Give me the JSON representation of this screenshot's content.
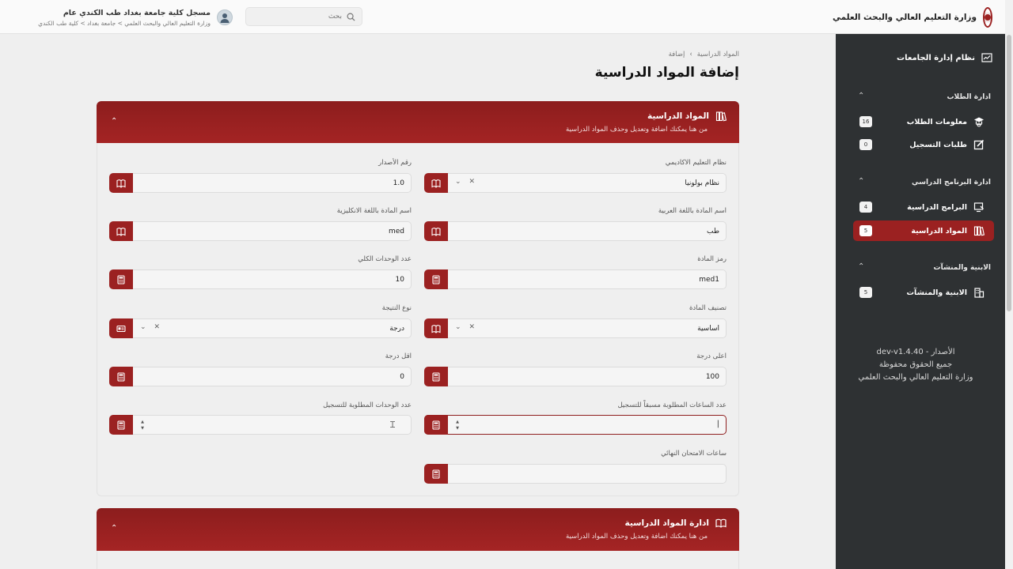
{
  "brand": {
    "title": "وزارة التعليم العالي والبحث العلمي"
  },
  "header": {
    "search_placeholder": "بحث",
    "user_name": "مسجل كلية جامعة بغداد طب الكندي عام",
    "user_path": "وزارة التعليم العالي والبحث العلمي > جامعة بغداد > كلية طب الكندي"
  },
  "sidebar": {
    "home": "نظام إدارة الجامعات",
    "sections": [
      {
        "title": "ادارة الطلاب",
        "items": [
          {
            "label": "معلومات الطلاب",
            "count": "16",
            "icon": "graduate-icon"
          },
          {
            "label": "طلبات التسجيل",
            "count": "0",
            "icon": "edit-icon"
          }
        ]
      },
      {
        "title": "ادارة البرنامج الدراسي",
        "items": [
          {
            "label": "البرامج الدراسية",
            "count": "4",
            "icon": "program-icon"
          },
          {
            "label": "المواد الدراسية",
            "count": "5",
            "icon": "books-icon",
            "active": true
          }
        ]
      },
      {
        "title": "الابنية والمنشآت",
        "items": [
          {
            "label": "الابنية والمنشآت",
            "count": "5",
            "icon": "building-icon"
          }
        ]
      }
    ],
    "footer": {
      "version": "الأصدار - dev-v1.4.40",
      "rights": "جميع الحقوق محفوظة",
      "ministry": "وزارة التعليم العالي والبحث العلمي"
    }
  },
  "breadcrumb": {
    "parent": "المواد الدراسية",
    "current": "إضافة",
    "separator": "›"
  },
  "page": {
    "title": "إضافة المواد الدراسية"
  },
  "card1": {
    "title": "المواد الدراسية",
    "subtitle": "من هنا يمكنك اضافة وتعديل وحذف المواد الدراسية",
    "fields": {
      "academic_system": {
        "label": "نظام التعليم الاكاديمي",
        "value": "نظام بولونيا"
      },
      "version": {
        "label": "رقم الأصدار",
        "value": "1.0"
      },
      "name_ar": {
        "label": "اسم المادة باللغة العربية",
        "value": "طب"
      },
      "name_en": {
        "label": "اسم المادة باللغة الانكليزية",
        "value": "med"
      },
      "code": {
        "label": "رمز المادة",
        "value": "med1"
      },
      "total_units": {
        "label": "عدد الوحدات الكلي",
        "value": "10"
      },
      "classification": {
        "label": "تصنيف المادة",
        "value": "أساسية"
      },
      "result_type": {
        "label": "نوع النتيجة",
        "value": "درجة"
      },
      "max_grade": {
        "label": "اعلى درجة",
        "value": "100"
      },
      "min_grade": {
        "label": "اقل درجة",
        "value": "0"
      },
      "prereq_hours": {
        "label": "عدد الساعات المطلوبة مسبقاً للتسجيل",
        "value": ""
      },
      "required_units": {
        "label": "عدد الوحدات المطلوبة للتسجيل",
        "value": ""
      },
      "final_exam_hours": {
        "label": "ساعات الامتحان النهائي",
        "value": ""
      }
    }
  },
  "card2": {
    "title": "ادارة المواد الدراسية",
    "subtitle": "من هنا يمكنك اضافة وتعديل وحذف المواد الدراسية"
  },
  "colors": {
    "primary": "#9b2121",
    "sidebar_bg": "#2e3133",
    "page_bg": "#efefef"
  }
}
